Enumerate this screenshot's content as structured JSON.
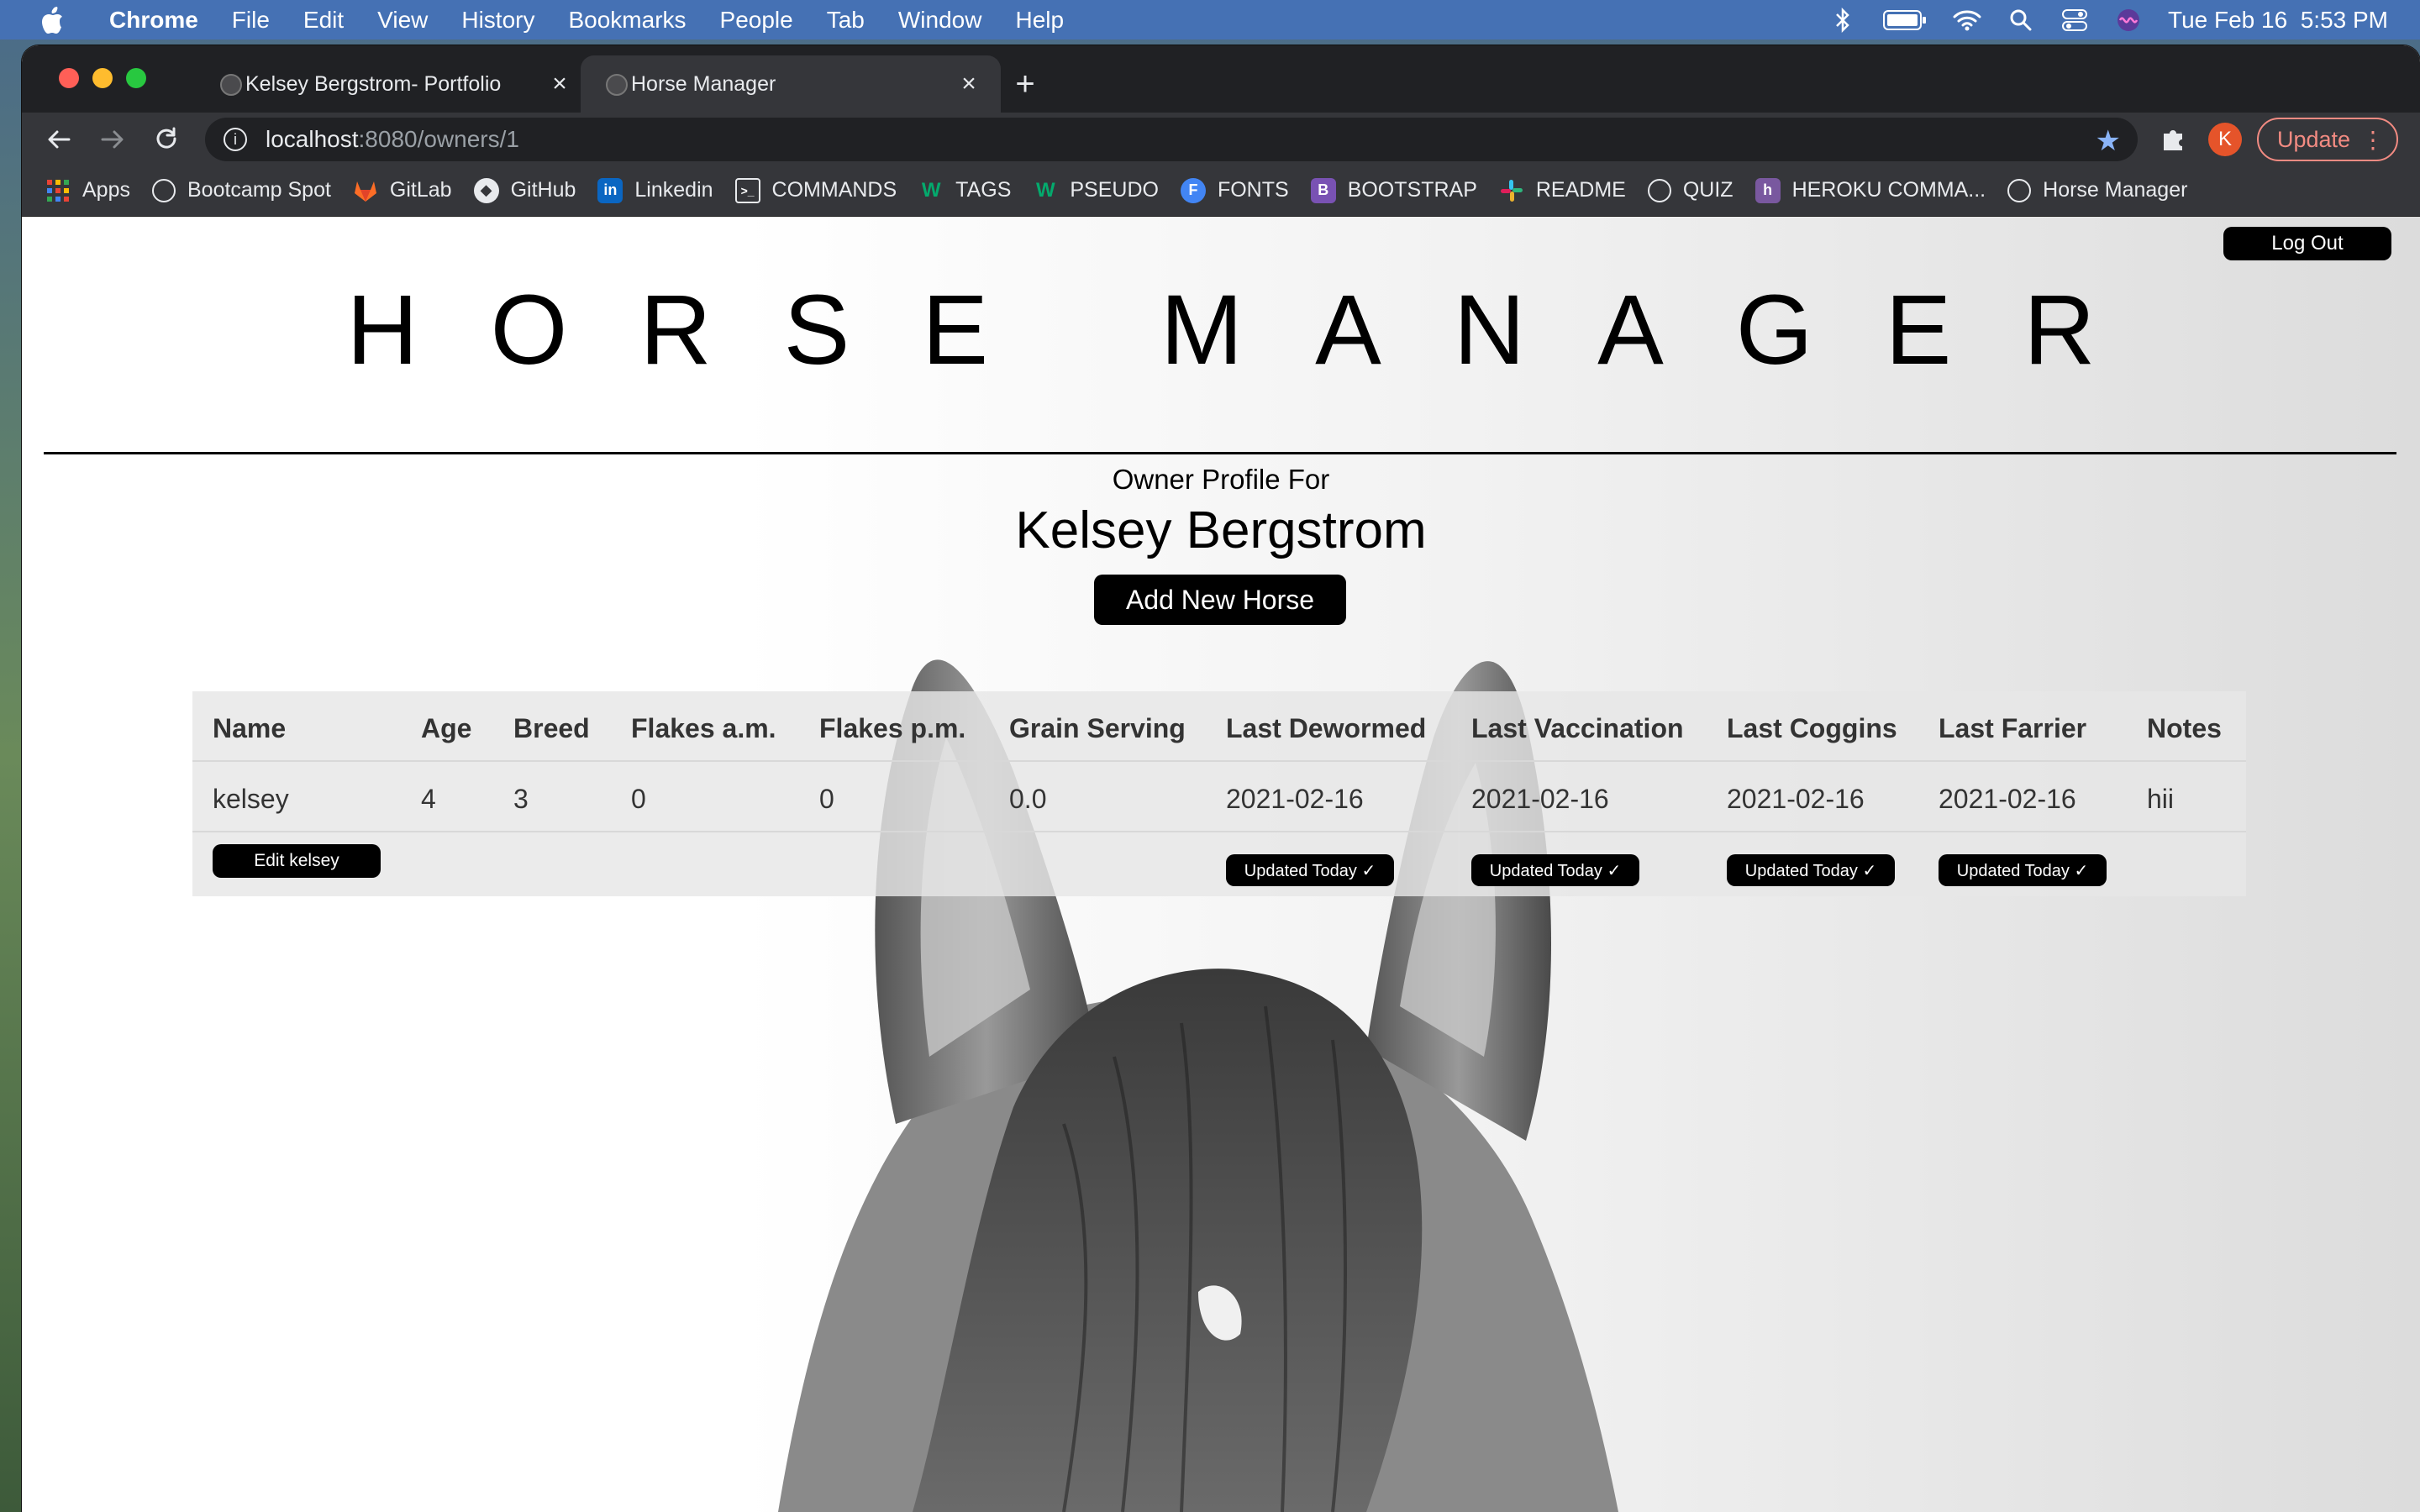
{
  "menubar": {
    "app": "Chrome",
    "items": [
      "File",
      "Edit",
      "View",
      "History",
      "Bookmarks",
      "People",
      "Tab",
      "Window",
      "Help"
    ],
    "clock": "Tue Feb 16  5:53 PM"
  },
  "browser": {
    "tabs": [
      {
        "title": "Kelsey Bergstrom- Portfolio",
        "active": false
      },
      {
        "title": "Horse Manager",
        "active": true
      }
    ],
    "url_host": "localhost",
    "url_path": ":8080/owners/1",
    "avatar_letter": "K",
    "update_label": "Update",
    "bookmarks": [
      {
        "label": "Apps",
        "icon": "apps-grid-icon"
      },
      {
        "label": "Bootcamp Spot",
        "icon": "globe-icon"
      },
      {
        "label": "GitLab",
        "icon": "gitlab-icon"
      },
      {
        "label": "GitHub",
        "icon": "github-icon"
      },
      {
        "label": "Linkedin",
        "icon": "linkedin-icon"
      },
      {
        "label": "COMMANDS",
        "icon": "terminal-icon"
      },
      {
        "label": "TAGS",
        "icon": "w3schools-icon"
      },
      {
        "label": "PSEUDO",
        "icon": "w3schools-icon"
      },
      {
        "label": "FONTS",
        "icon": "fonts-icon"
      },
      {
        "label": "BOOTSTRAP",
        "icon": "bootstrap-icon"
      },
      {
        "label": "README",
        "icon": "slack-icon"
      },
      {
        "label": "QUIZ",
        "icon": "globe-icon"
      },
      {
        "label": "HEROKU COMMA...",
        "icon": "heroku-icon"
      },
      {
        "label": "Horse Manager",
        "icon": "globe-icon"
      }
    ]
  },
  "page": {
    "logout_label": "Log Out",
    "title": "HORSE MANAGER",
    "subtitle": "Owner Profile For",
    "owner_name": "Kelsey Bergstrom",
    "add_horse_label": "Add New Horse",
    "table": {
      "headers": [
        "Name",
        "Age",
        "Breed",
        "Flakes a.m.",
        "Flakes p.m.",
        "Grain Serving",
        "Last Dewormed",
        "Last Vaccination",
        "Last Coggins",
        "Last Farrier",
        "Notes"
      ],
      "rows": [
        {
          "name": "kelsey",
          "age": "4",
          "breed": "3",
          "flakes_am": "0",
          "flakes_pm": "0",
          "grain": "0.0",
          "dewormed": "2021-02-16",
          "vaccination": "2021-02-16",
          "coggins": "2021-02-16",
          "farrier": "2021-02-16",
          "notes": "hii",
          "edit_label": "Edit kelsey",
          "updated_label": "Updated Today ✓"
        }
      ]
    }
  }
}
